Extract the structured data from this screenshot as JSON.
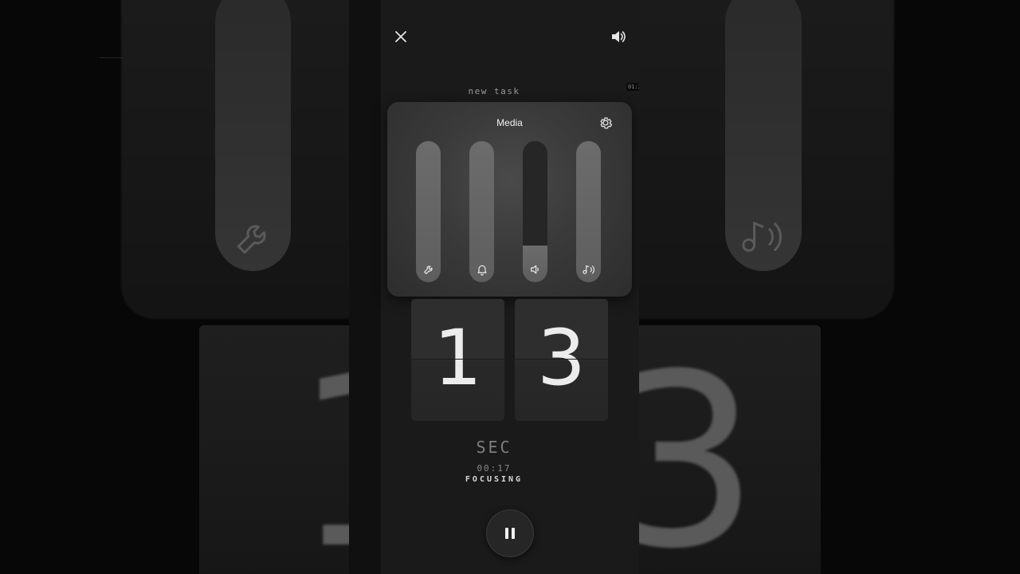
{
  "header": {
    "close_icon": "close-icon",
    "sound_icon": "speaker-icon"
  },
  "task": {
    "label": "new task"
  },
  "mini_time": "01:2",
  "volume_panel": {
    "title": "Media",
    "settings_icon": "gear-icon",
    "sliders": [
      {
        "name": "system",
        "icon": "wrench-icon",
        "level": 1.0
      },
      {
        "name": "ring",
        "icon": "bell-icon",
        "level": 1.0
      },
      {
        "name": "media",
        "icon": "speaker-low-icon",
        "level": 0.26
      },
      {
        "name": "notification",
        "icon": "music-icon",
        "level": 1.0
      }
    ]
  },
  "timer": {
    "digits": [
      "1",
      "3"
    ],
    "unit": "SEC",
    "elapsed": "00:17",
    "status": "FOCUSING"
  },
  "controls": {
    "pause_icon": "pause-icon"
  },
  "colors": {
    "background": "#000000",
    "panel": "#3a3a3a",
    "card": "#2e2e2e",
    "text": "#ececec"
  }
}
